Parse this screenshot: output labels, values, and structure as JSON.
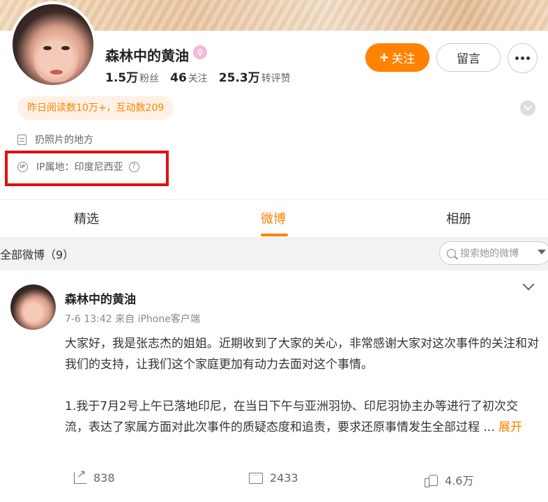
{
  "profile": {
    "name": "森林中的黄油",
    "vip_badge": "♀",
    "stats": [
      {
        "value": "1.5万",
        "label": "粉丝"
      },
      {
        "value": "46",
        "label": "关注"
      },
      {
        "value": "25.3万",
        "label": "转评赞"
      }
    ],
    "follow_label": "关注",
    "message_label": "留言",
    "reads_summary": "昨日阅读数10万+，互动数209",
    "bio": "扔照片的地方",
    "ip_location": "IP属地：印度尼西亚",
    "ip_icon_text": "IP"
  },
  "tabs": [
    {
      "label": "精选",
      "active": false
    },
    {
      "label": "微博",
      "active": true
    },
    {
      "label": "相册",
      "active": false
    }
  ],
  "filter": {
    "title": "全部微博（9）",
    "search_placeholder": "搜索她的微博"
  },
  "post": {
    "author": "森林中的黄油",
    "meta": "7-6 13:42 来自 iPhone客户端",
    "paragraph1": "大家好，我是张志杰的姐姐。近期收到了大家的关心，非常感谢大家对这次事件的关注和对我们的支持，让我们这个家庭更加有动力去面对这个事情。",
    "paragraph2": "1.我于7月2号上午已落地印尼，在当日下午与亚洲羽协、印尼羽协主办等进行了初次交流，表达了家属方面对此次事件的质疑态度和追责，要求还原事情发生全部过程",
    "ellipsis": " ... ",
    "expand_label": "展开",
    "actions": {
      "reposts": "838",
      "comments": "2433",
      "likes": "4.6万"
    }
  },
  "colors": {
    "accent": "#ff8200",
    "highlight_border": "#e01010"
  }
}
